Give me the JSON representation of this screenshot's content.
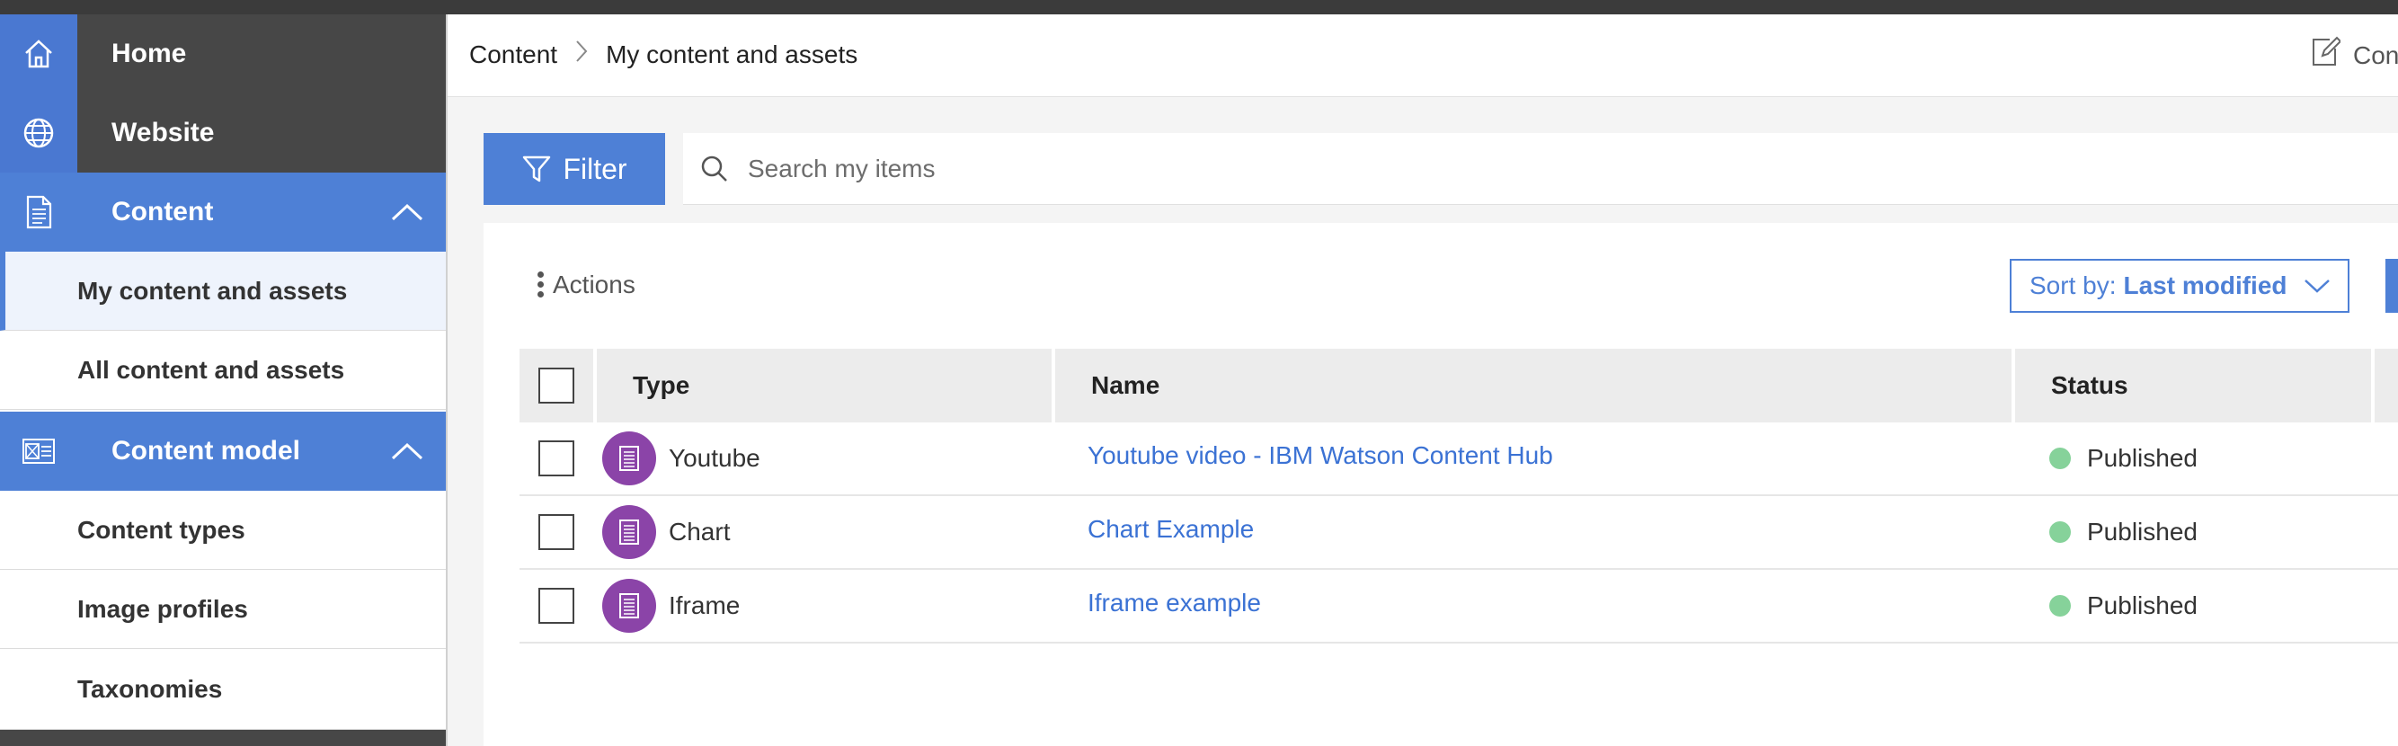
{
  "sidebar": {
    "items": [
      {
        "label": "Home",
        "icon": "home-icon"
      },
      {
        "label": "Website",
        "icon": "globe-icon"
      },
      {
        "label": "Content",
        "icon": "document-icon"
      },
      {
        "label": "Content model",
        "icon": "content-model-icon"
      }
    ],
    "content_sub": [
      {
        "label": "My content and assets",
        "active": true
      },
      {
        "label": "All content and assets",
        "active": false
      }
    ],
    "model_sub": [
      {
        "label": "Content types"
      },
      {
        "label": "Image profiles"
      },
      {
        "label": "Taxonomies"
      }
    ]
  },
  "header": {
    "breadcrumb": [
      "Content",
      "My content and assets"
    ],
    "edit_label": "Con"
  },
  "toolbar": {
    "filter_label": "Filter",
    "search_placeholder": "Search my items"
  },
  "panel": {
    "actions_label": "Actions",
    "sort_prefix": "Sort by:",
    "sort_value": "Last modified"
  },
  "table": {
    "columns": [
      "Type",
      "Name",
      "Status"
    ],
    "rows": [
      {
        "type": "Youtube",
        "name": "Youtube video - IBM Watson Content Hub",
        "status": "Published"
      },
      {
        "type": "Chart",
        "name": "Chart Example",
        "status": "Published"
      },
      {
        "type": "Iframe",
        "name": "Iframe example",
        "status": "Published"
      }
    ]
  },
  "colors": {
    "accent": "#4e80d6",
    "nav_dark": "#474747",
    "type_icon": "#8b44a8",
    "published": "#86d29a",
    "link": "#3b72d4"
  }
}
